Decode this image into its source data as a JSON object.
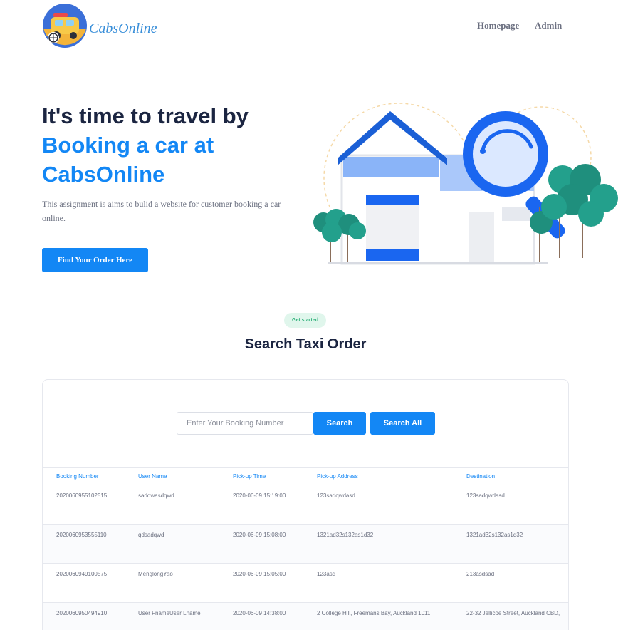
{
  "header": {
    "brand": "CabsOnline",
    "nav": {
      "home": "Homepage",
      "admin": "Admin"
    }
  },
  "hero": {
    "title_line1": "It's time to travel by",
    "title_highlight": "Booking a car at CabsOnline",
    "description": "This assignment is aims to bulid a website for customer booking a car online.",
    "cta": "Find Your Order Here"
  },
  "section": {
    "badge": "Get started",
    "title": "Search Taxi Order"
  },
  "search": {
    "placeholder": "Enter Your Booking Number",
    "value": "",
    "search_label": "Search",
    "search_all_label": "Search All"
  },
  "table": {
    "headers": [
      "Booking Number",
      "User Name",
      "Pick-up Time",
      "Pick-up Address",
      "Destination"
    ],
    "rows": [
      [
        "2020060955102515",
        "sadqwasdqwd",
        "2020-06-09 15:19:00",
        "123sadqwdasd",
        "123sadqwdasd"
      ],
      [
        "2020060953555110",
        "qdsadqwd",
        "2020-06-09 15:08:00",
        "1321ad32s132as1d32",
        "1321ad32s132as1d32"
      ],
      [
        "2020060949100575",
        "MenglongYao",
        "2020-06-09 15:05:00",
        "123asd",
        "213asdsad"
      ],
      [
        "2020060950494910",
        "User FnameUser Lname",
        "2020-06-09 14:38:00",
        "2 College Hill, Freemans Bay, Auckland 1011",
        "22-32 Jellicoe Street, Auckland CBD,"
      ]
    ]
  },
  "colors": {
    "primary": "#1387f5",
    "heading": "#1b2541",
    "muted": "#6b7080",
    "badge_bg": "#e0f6ec",
    "badge_text": "#36b37e"
  }
}
